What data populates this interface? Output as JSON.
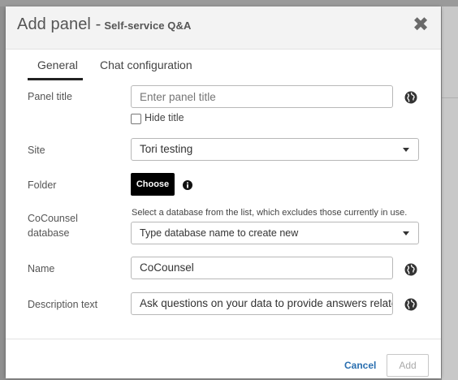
{
  "dialog": {
    "title": "Add panel -",
    "subtitle": "Self-service Q&A",
    "close_icon": "close-icon"
  },
  "tabs": [
    {
      "label": "General",
      "active": true
    },
    {
      "label": "Chat configuration",
      "active": false
    }
  ],
  "form": {
    "panel_title": {
      "label": "Panel title",
      "value": "",
      "placeholder": "Enter panel title",
      "hide_title_label": "Hide title",
      "hide_title_checked": false
    },
    "site": {
      "label": "Site",
      "value": "Tori testing"
    },
    "folder": {
      "label": "Folder",
      "button_label": "Choose"
    },
    "database": {
      "label_line1": "CoCounsel",
      "label_line2": "database",
      "hint": "Select a database from the list, which excludes those currently in use.",
      "placeholder": "Type database name to create new"
    },
    "name": {
      "label": "Name",
      "value": "CoCounsel"
    },
    "description": {
      "label": "Description text",
      "value": "Ask questions on your data to provide answers relate"
    }
  },
  "footer": {
    "cancel_label": "Cancel",
    "add_label": "Add"
  },
  "colors": {
    "accent_link": "#2a6fb0",
    "button_dark": "#000000",
    "header_bg": "#f3f3f3"
  }
}
